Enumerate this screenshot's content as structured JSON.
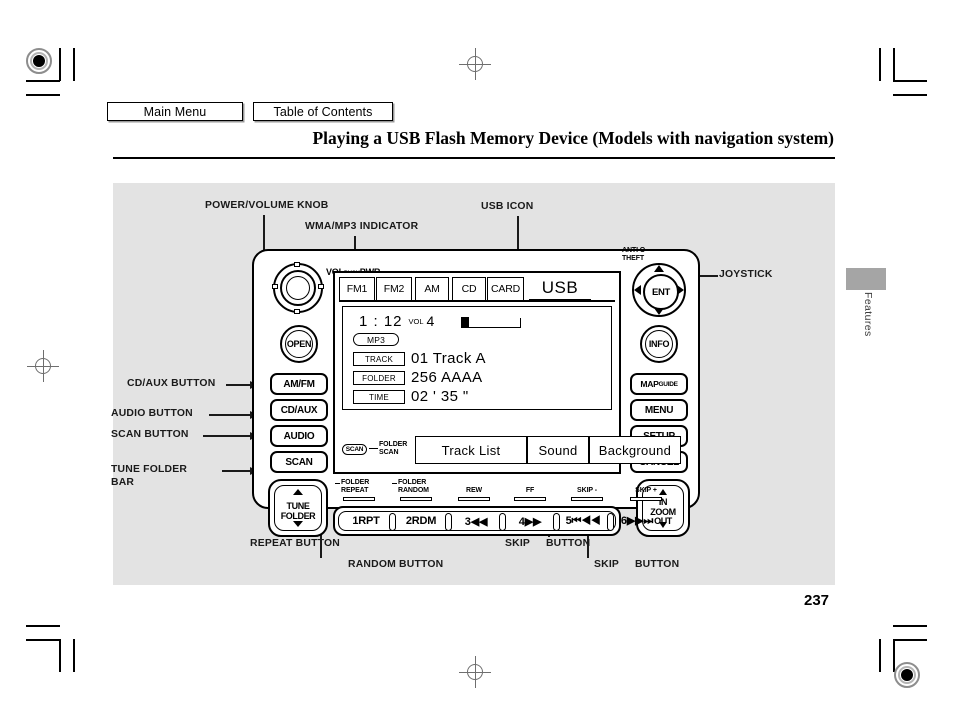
{
  "header": {
    "main_menu_label": "Main Menu",
    "toc_label": "Table of Contents"
  },
  "page": {
    "title": "Playing a USB Flash Memory Device (Models with navigation system)",
    "section_tab": "Features",
    "number": "237"
  },
  "callouts": {
    "power_volume_knob": "POWER/VOLUME KNOB",
    "wma_mp3_indicator": "WMA/MP3 INDICATOR",
    "usb_icon": "USB ICON",
    "joystick": "JOYSTICK",
    "cd_aux_button": "CD/AUX BUTTON",
    "audio_button": "AUDIO BUTTON",
    "scan_button": "SCAN BUTTON",
    "tune_folder_bar_line1": "TUNE FOLDER",
    "tune_folder_bar_line2": "BAR",
    "repeat_button": "REPEAT BUTTON",
    "random_button": "RANDOM BUTTON",
    "skip_minus_button_a": "SKIP",
    "skip_minus_button_b": "BUTTON",
    "skip_plus_button_a": "SKIP",
    "skip_plus_button_b": "BUTTON"
  },
  "unit": {
    "knob_text_vol": "VOL",
    "knob_text_push": "PUSH",
    "knob_text_pwr": "PWR",
    "anti_theft_line1": "ANTI  O",
    "anti_theft_line2": "THEFT",
    "open_label": "OPEN",
    "ent_label": "ENT",
    "info_label": "INFO",
    "left_buttons": [
      {
        "label": "AM/FM"
      },
      {
        "label": "CD/AUX"
      },
      {
        "label": "AUDIO"
      },
      {
        "label": "SCAN"
      }
    ],
    "right_buttons": [
      {
        "label_main": "MAP",
        "label_sub": "GUIDE"
      },
      {
        "label_main": "MENU",
        "label_sub": ""
      },
      {
        "label_main": "SETUP",
        "label_sub": ""
      },
      {
        "label_main": "CANCEL",
        "label_sub": ""
      }
    ],
    "tune_folder": {
      "line1": "TUNE",
      "line2": "FOLDER"
    },
    "zoom": {
      "line1": "IN",
      "line2": "ZOOM",
      "line3": "OUT"
    }
  },
  "screen": {
    "tabs": [
      {
        "label": "FM1",
        "selected": false
      },
      {
        "label": "FM2",
        "selected": false
      },
      {
        "label": "AM",
        "selected": false
      },
      {
        "label": "CD",
        "selected": false
      },
      {
        "label": "CARD",
        "selected": false
      },
      {
        "label": "USB",
        "selected": true
      }
    ],
    "clock": "1 : 12",
    "volume_label": "VOL",
    "volume_value": "4",
    "format_indicator": "MP3",
    "rows": [
      {
        "tag": "TRACK",
        "value": "01  Track A"
      },
      {
        "tag": "FOLDER",
        "value": "256 AAAA"
      },
      {
        "tag": "TIME",
        "value": "02 ' 35 \""
      }
    ],
    "scan_tag": "SCAN",
    "folder_scan_line1": "FOLDER",
    "folder_scan_line2": "SCAN",
    "softkeys": [
      {
        "label": "Track  List"
      },
      {
        "label": "Sound"
      },
      {
        "label": "Background"
      }
    ]
  },
  "legend": [
    {
      "line1": "FOLDER",
      "line2": "REPEAT",
      "hook": true
    },
    {
      "line1": "FOLDER",
      "line2": "RANDOM",
      "hook": true
    },
    {
      "line1": "REW",
      "line2": "",
      "hook": false
    },
    {
      "line1": "FF",
      "line2": "",
      "hook": false
    },
    {
      "line1": "SKIP -",
      "line2": "",
      "hook": false
    },
    {
      "line1": "SKIP +",
      "line2": "",
      "hook": false
    }
  ],
  "presets": [
    {
      "label": "1RPT"
    },
    {
      "label": "2RDM"
    },
    {
      "label": "3◀◀"
    },
    {
      "label": "4▶▶"
    },
    {
      "label": "5⏮◀◀"
    },
    {
      "label": "6▶▶⏭"
    }
  ],
  "colors": {
    "panel_bg": "#e3e3e3",
    "ink": "#000000",
    "tab_gray": "#a5a5a5",
    "shadow": "#9a9a9a"
  }
}
